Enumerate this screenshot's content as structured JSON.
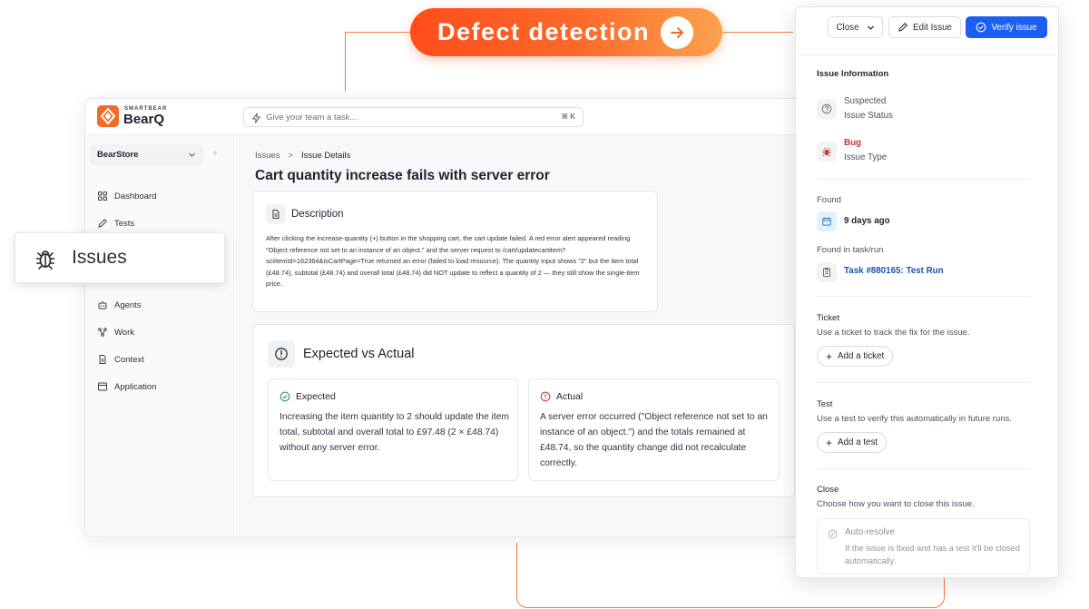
{
  "banner": {
    "label": "Defect detection"
  },
  "app": {
    "brand_small": "SMARTBEAR",
    "brand_name": "BearQ",
    "search_placeholder": "Give your team a task...",
    "search_shortcut": "⌘ K",
    "project": "BearStore",
    "project_add": "+",
    "nav": [
      {
        "label": "Dashboard",
        "icon": "grid-icon"
      },
      {
        "label": "Tests",
        "icon": "pencil-icon"
      },
      {
        "label": "Agents",
        "icon": "robot-icon"
      },
      {
        "label": "Work",
        "icon": "workflow-icon"
      },
      {
        "label": "Context",
        "icon": "document-icon"
      },
      {
        "label": "Application",
        "icon": "window-icon"
      }
    ],
    "issues_callout": "Issues",
    "breadcrumb": {
      "root": "Issues",
      "sep": ">",
      "current": "Issue Details"
    },
    "title": "Cart quantity increase fails with server error",
    "description": {
      "title": "Description",
      "body": "After clicking the increase-quantity (+) button in the shopping cart, the cart update failed. A red error alert appeared reading \"Object reference not set to an instance of an object.\" and the server request to /cart/updatecartitem?sciItemId=162364&isCartPage=True returned an error (failed to load resource). The quantity input shows \"2\" but the item total (£48.74), subtotal (£48.74) and overall total (£48.74) did NOT update to reflect a quantity of 2 — they still show the single-item price."
    },
    "expected_vs_actual": {
      "title": "Expected vs Actual",
      "expected_title": "Expected",
      "expected_body": "Increasing the item quantity to 2 should update the item total, subtotal and overall total to £97.48 (2 × £48.74) without any server error.",
      "actual_title": "Actual",
      "actual_body": "A server error occurred (\"Object reference not set to an instance of an object.\") and the totals remained at £48.74, so the quantity change did not recalculate correctly."
    }
  },
  "panel": {
    "close_label": "Close",
    "edit_label": "Edit Issue",
    "verify_label": "Verify issue",
    "info_heading": "Issue Information",
    "status_value": "Suspected",
    "status_label": "Issue Status",
    "type_value": "Bug",
    "type_label": "Issue Type",
    "found_heading": "Found",
    "found_value": "9 days ago",
    "found_in_heading": "Found in task/run",
    "found_in_value": "Task #880165: Test Run",
    "ticket_heading": "Ticket",
    "ticket_desc": "Use a ticket to track the fix for the issue.",
    "ticket_button": "Add a ticket",
    "test_heading": "Test",
    "test_desc": "Use a test to verify this automatically in future runs.",
    "test_button": "Add a test",
    "close_heading": "Close",
    "close_desc": "Choose how you want to close this issue.",
    "auto_title": "Auto-resolve",
    "auto_desc": "If the issue is fixed and has a test it'll be closed automatically."
  },
  "colors": {
    "accent_orange": "#f26a26",
    "verify_blue": "#1b5ef2",
    "bug_red": "#c6373b",
    "link_blue": "#1f4fb3"
  }
}
